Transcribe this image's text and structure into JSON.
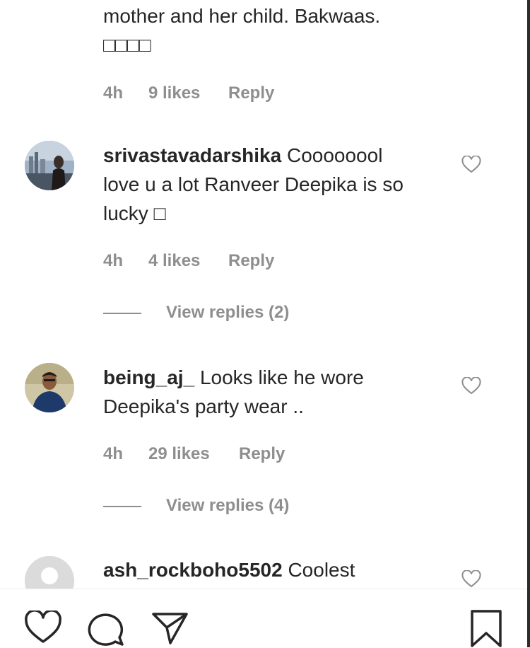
{
  "comments": [
    {
      "partial_text": "mother and her child. Bakwaas.",
      "emoji": "□□□□",
      "time": "4h",
      "likes": "9 likes",
      "reply": "Reply"
    },
    {
      "username": "srivastavadarshika",
      "text_line1": " Coooooool",
      "text_line2": "love u a lot Ranveer Deepika is so",
      "text_line3": "lucky □",
      "time": "4h",
      "likes": "4 likes",
      "reply": "Reply",
      "view_replies": "View replies (2)"
    },
    {
      "username": "being_aj_",
      "text_line1": " Looks like he wore",
      "text_line2": "Deepika's party wear ..",
      "time": "4h",
      "likes": "29 likes",
      "reply": "Reply",
      "view_replies": "View replies (4)"
    },
    {
      "username": "ash_rockboho5502",
      "text_line1": " Coolest"
    }
  ],
  "actions": {
    "icons": [
      "heart-icon",
      "comment-icon",
      "share-icon",
      "bookmark-icon"
    ]
  },
  "colors": {
    "text": "#262626",
    "secondary": "#8e8e8e",
    "border": "#efefef"
  }
}
